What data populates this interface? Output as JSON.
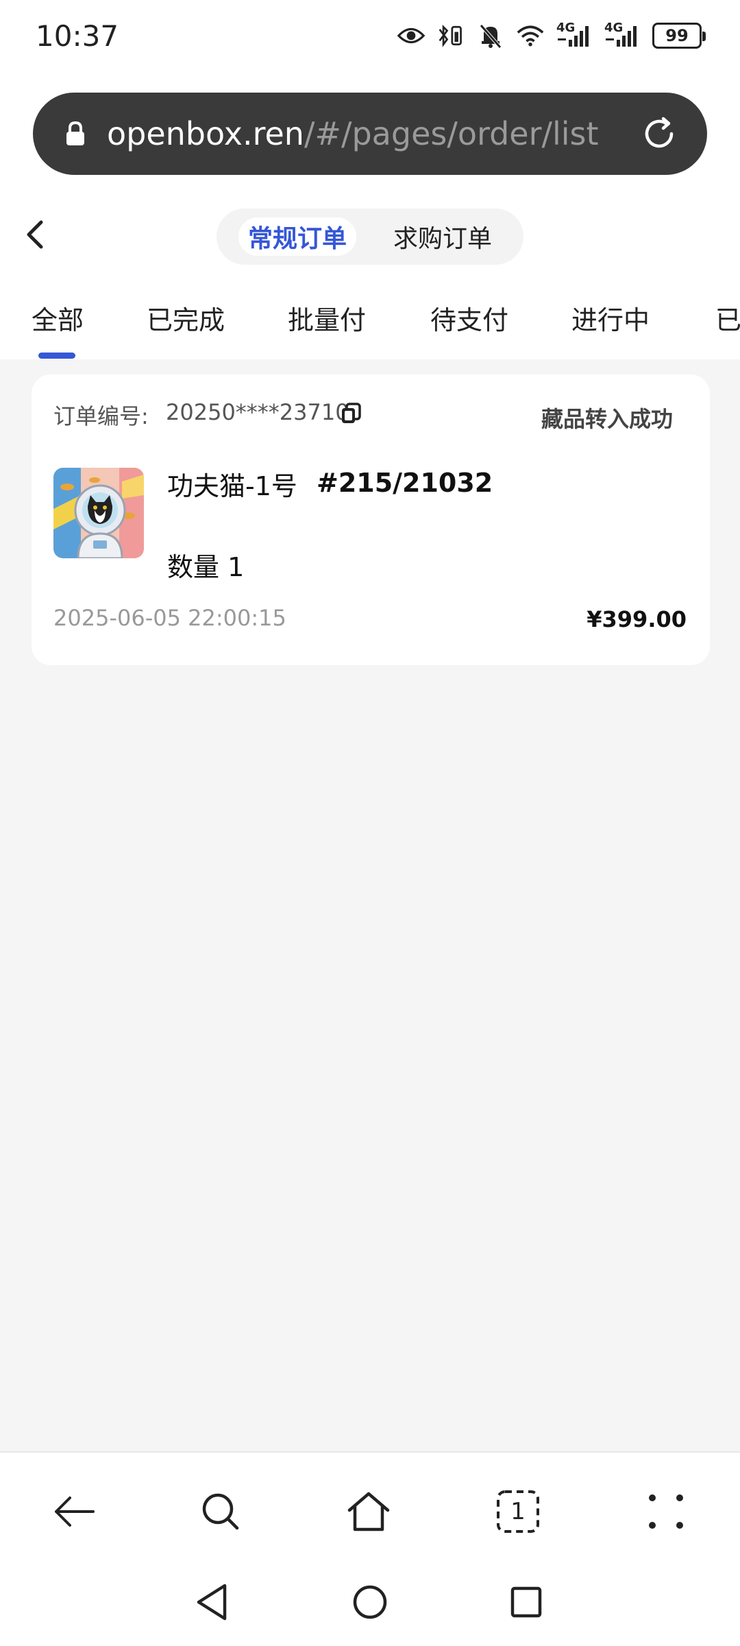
{
  "status_bar": {
    "time": "10:37",
    "signal1_label": "4G",
    "signal2_label": "4G",
    "battery": "99",
    "icons": [
      "eye-icon",
      "bluetooth-battery-icon",
      "bell-off-icon",
      "wifi-icon",
      "signal-icon",
      "signal-icon",
      "battery-icon"
    ]
  },
  "address_bar": {
    "host": "openbox.ren",
    "path": "/#/pages/order/list"
  },
  "header": {
    "segments": [
      "常规订单",
      "求购订单"
    ],
    "active_segment": "常规订单"
  },
  "tabs": {
    "items": [
      "全部",
      "已完成",
      "批量付",
      "待支付",
      "进行中",
      "已"
    ],
    "active": "全部"
  },
  "orders": [
    {
      "order_no_label": "订单编号:",
      "order_no": "20250****23710",
      "status": "藏品转入成功",
      "item_name": "功夫猫-1号",
      "serial": "#215/21032",
      "qty_label": "数量",
      "qty": "1",
      "time": "2025-06-05 22:00:15",
      "price": "¥399.00"
    }
  ],
  "toolbar": {
    "tab_count": "1"
  },
  "colors": {
    "accent": "#3557d6",
    "page_bg": "#f5f5f5",
    "url_bar": "#3a3a3a"
  }
}
